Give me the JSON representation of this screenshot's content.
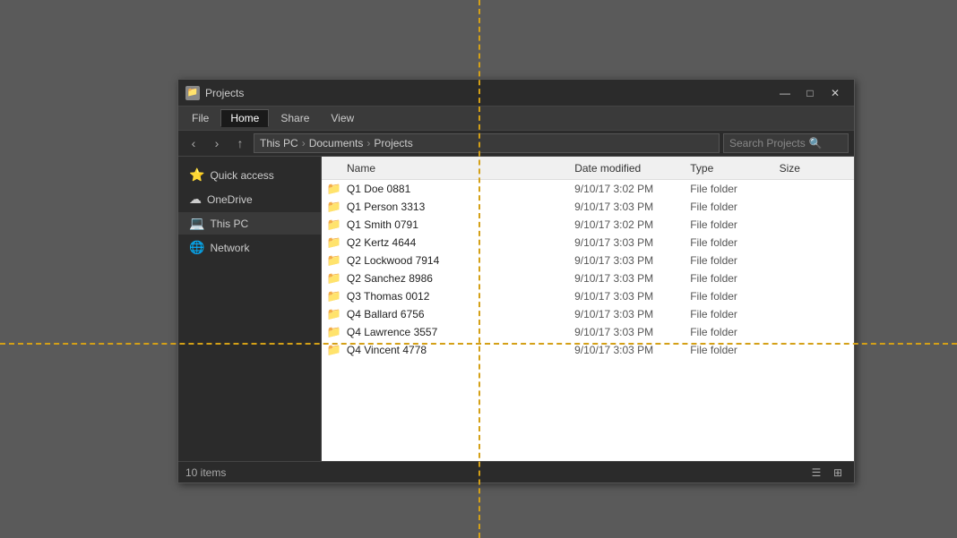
{
  "window": {
    "title": "Projects",
    "titlebar_buttons": [
      "minimize",
      "maximize",
      "close"
    ]
  },
  "ribbon": {
    "tabs": [
      "File",
      "Home",
      "Share",
      "View"
    ],
    "active_tab": "Home"
  },
  "addressbar": {
    "path_parts": [
      "This PC",
      "Documents",
      "Projects"
    ],
    "search_placeholder": "Search Projects"
  },
  "sidebar": {
    "items": [
      {
        "label": "Quick access",
        "icon": "⭐"
      },
      {
        "label": "OneDrive",
        "icon": "☁"
      },
      {
        "label": "This PC",
        "icon": "🖥"
      },
      {
        "label": "Network",
        "icon": "🌐"
      }
    ]
  },
  "columns": {
    "name": "Name",
    "date_modified": "Date modified",
    "type": "Type",
    "size": "Size"
  },
  "files": [
    {
      "name": "Q1 Doe 0881",
      "date": "9/10/17 3:02 PM",
      "type": "File folder",
      "size": ""
    },
    {
      "name": "Q1 Person 3313",
      "date": "9/10/17 3:03 PM",
      "type": "File folder",
      "size": ""
    },
    {
      "name": "Q1 Smith 0791",
      "date": "9/10/17 3:02 PM",
      "type": "File folder",
      "size": ""
    },
    {
      "name": "Q2 Kertz 4644",
      "date": "9/10/17 3:03 PM",
      "type": "File folder",
      "size": ""
    },
    {
      "name": "Q2 Lockwood 7914",
      "date": "9/10/17 3:03 PM",
      "type": "File folder",
      "size": ""
    },
    {
      "name": "Q2 Sanchez 8986",
      "date": "9/10/17 3:03 PM",
      "type": "File folder",
      "size": ""
    },
    {
      "name": "Q3 Thomas 0012",
      "date": "9/10/17 3:03 PM",
      "type": "File folder",
      "size": ""
    },
    {
      "name": "Q4 Ballard 6756",
      "date": "9/10/17 3:03 PM",
      "type": "File folder",
      "size": ""
    },
    {
      "name": "Q4 Lawrence 3557",
      "date": "9/10/17 3:03 PM",
      "type": "File folder",
      "size": ""
    },
    {
      "name": "Q4 Vincent 4778",
      "date": "9/10/17 3:03 PM",
      "type": "File folder",
      "size": ""
    }
  ],
  "statusbar": {
    "item_count": "10 items"
  },
  "colors": {
    "crosshair": "#d4a017",
    "folder": "#c8a951",
    "window_bg": "#2b2b2b",
    "file_area_bg": "#ffffff"
  }
}
